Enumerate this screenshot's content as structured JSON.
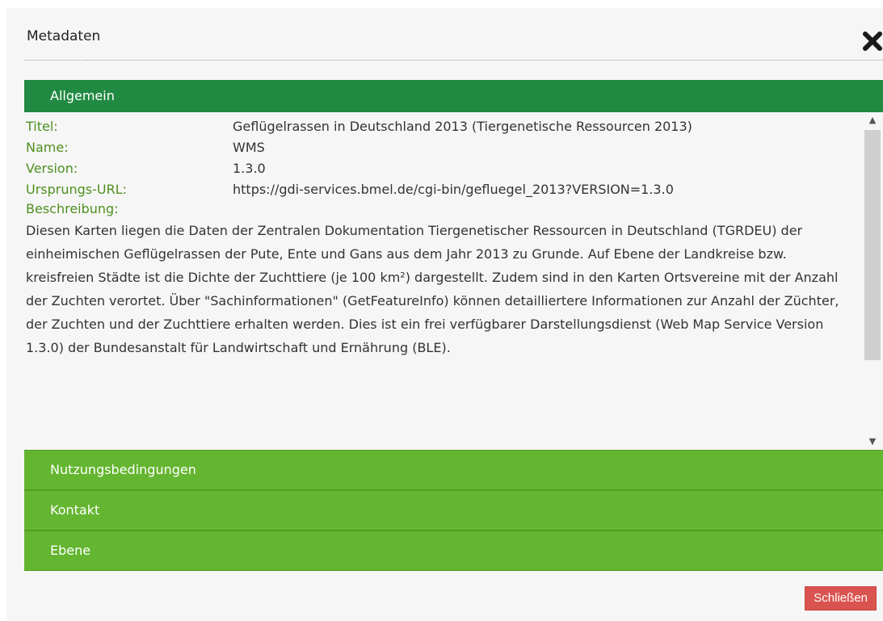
{
  "dialog": {
    "title": "Metadaten",
    "close_icon": "close-icon",
    "close_button_label": "Schließen"
  },
  "accordion": {
    "sections": [
      {
        "label": "Allgemein",
        "expanded": true
      },
      {
        "label": "Nutzungsbedingungen",
        "expanded": false
      },
      {
        "label": "Kontakt",
        "expanded": false
      },
      {
        "label": "Ebene",
        "expanded": false
      }
    ]
  },
  "general": {
    "rows": [
      {
        "label": "Titel:",
        "value": "Geflügelrassen in Deutschland 2013 (Tiergenetische Ressourcen 2013)"
      },
      {
        "label": "Name:",
        "value": "WMS"
      },
      {
        "label": "Version:",
        "value": "1.3.0"
      },
      {
        "label": "Ursprungs-URL:",
        "value": "https://gdi-services.bmel.de/cgi-bin/gefluegel_2013?VERSION=1.3.0"
      }
    ],
    "description_label": "Beschreibung:",
    "description": "Diesen Karten liegen die Daten der Zentralen Dokumentation Tiergenetischer Ressourcen in Deutschland (TGRDEU) der einheimischen Geflügelrassen der Pute, Ente und Gans aus dem Jahr 2013 zu Grunde. Auf Ebene der Landkreise bzw. kreisfreien Städte ist die Dichte der Zuchttiere (je 100 km²) dargestellt. Zudem sind in den Karten Ortsvereine mit der Anzahl der Zuchten verortet. Über \"Sachinformationen\" (GetFeatureInfo) können detailliertere Informationen zur Anzahl der Züchter, der Zuchten und der Zuchttiere erhalten werden. Dies ist ein frei verfügbarer Darstellungsdienst (Web Map Service Version 1.3.0) der Bundesanstalt für Landwirtschaft und Ernährung (BLE)."
  },
  "colors": {
    "active_header": "#218a42",
    "collapsed_header": "#64b530",
    "label_green": "#4e8f1f",
    "close_button": "#d9534f"
  }
}
